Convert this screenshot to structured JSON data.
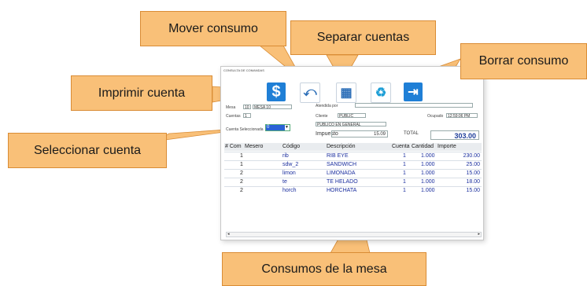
{
  "window": {
    "title": "CONSULTA DE COMANDAS"
  },
  "toolbar": [
    {
      "name": "imprimir-cuenta-button",
      "icon": "dollar-icon",
      "glyph": "$",
      "color": "#1f7fd6"
    },
    {
      "name": "mover-consumo-button",
      "icon": "move-consumption-icon",
      "glyph": "⤺",
      "color": "#2d6fb8"
    },
    {
      "name": "separar-cuentas-button",
      "icon": "calculator-icon",
      "glyph": "▦",
      "color": "#2d6fb8"
    },
    {
      "name": "borrar-consumo-button",
      "icon": "trash-icon",
      "glyph": "♻",
      "color": "#1f9fd6"
    },
    {
      "name": "salir-button",
      "icon": "exit-door-icon",
      "glyph": "⇥",
      "color": "#1f7fd6"
    }
  ],
  "form": {
    "mesa_label": "Mesa",
    "mesa_num": "10",
    "mesa_name": "MESA 10",
    "cuentas_label": "Cuentas",
    "cuentas_value": "1",
    "cuenta_sel_label": "Cuenta Seleccionada",
    "cuenta_sel_value": "0",
    "atendida_label": "Atendida por",
    "atendida_value": "",
    "cliente_label": "Cliente",
    "cliente_value": "PUBLIC",
    "ocupado_label": "Ocupado",
    "ocupado_value": "12:59:06 PM",
    "cliente_name": "PUBLICO EN GENERAL",
    "impuesto_label": "Impuesto",
    "impuesto_value": "15.09",
    "total_label": "TOTAL",
    "total_value": "303.00"
  },
  "table": {
    "headers": [
      "# Com",
      "Mesero",
      "Código",
      "Descripción",
      "Cuenta",
      "Cantidad",
      "Importe"
    ],
    "rows": [
      [
        "1",
        "",
        "rib",
        "RIB EYE",
        "1",
        "1.000",
        "230.00"
      ],
      [
        "1",
        "",
        "sdw_2",
        "SANDWICH",
        "1",
        "1.000",
        "25.00"
      ],
      [
        "2",
        "",
        "limon",
        "LIMONADA",
        "1",
        "1.000",
        "15.00"
      ],
      [
        "2",
        "",
        "te",
        "TE HELADO",
        "1",
        "1.000",
        "18.00"
      ],
      [
        "2",
        "",
        "horch",
        "HORCHATA",
        "1",
        "1.000",
        "15.00"
      ]
    ]
  },
  "callouts": {
    "mover": "Mover consumo",
    "separar": "Separar cuentas",
    "borrar": "Borrar consumo",
    "imprimir": "Imprimir cuenta",
    "seleccionar": "Seleccionar cuenta",
    "consumos": "Consumos de la mesa"
  },
  "colors": {
    "callout_fill": "#f9c078",
    "callout_border": "#d98c35",
    "link_text": "#1a2e9e",
    "total_text": "#1f3f9a"
  }
}
